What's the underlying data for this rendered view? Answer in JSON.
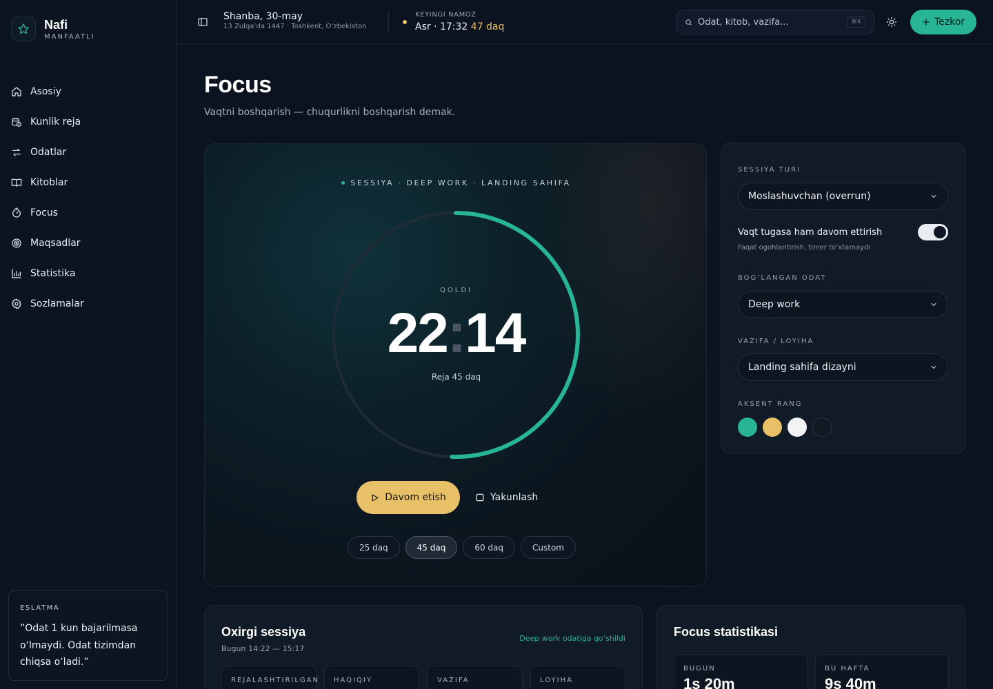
{
  "brand": {
    "name": "Nafi",
    "sub": "MANFAATLI"
  },
  "sidebar": {
    "items": [
      {
        "label": "Asosiy",
        "icon": "home-icon"
      },
      {
        "label": "Kunlik reja",
        "icon": "calendar-clock-icon"
      },
      {
        "label": "Odatlar",
        "icon": "repeat-icon"
      },
      {
        "label": "Kitoblar",
        "icon": "book-icon"
      },
      {
        "label": "Focus",
        "icon": "timer-icon"
      },
      {
        "label": "Maqsadlar",
        "icon": "target-icon"
      },
      {
        "label": "Statistika",
        "icon": "bar-chart-icon"
      },
      {
        "label": "Sozlamalar",
        "icon": "gear-icon"
      }
    ],
    "reminder": {
      "title": "ESLATMA",
      "text": "”Odat 1 kun bajarilmasa o‘lmaydi. Odat tizimdan chiqsa o‘ladi.”"
    }
  },
  "header": {
    "date_main": "Shanba, 30-may",
    "date_sub": "13 Zulqa’da 1447 · Toshkent, O‘zbekiston",
    "prayer_label": "KEYINGI NAMOZ",
    "prayer_value": "Asr · 17:32",
    "prayer_remaining": "47 daq",
    "search_placeholder": "Odat, kitob, vazifa...",
    "search_shortcut": "⌘K",
    "quick_label": "Tezkor"
  },
  "page": {
    "title": "Focus",
    "subtitle": "Vaqtni boshqarish — chuqurlikni boshqarish demak."
  },
  "timer": {
    "session_tag": "SESSIYA · DEEP WORK · LANDING SAHIFA",
    "remaining_label": "QOLDI",
    "minutes": "22",
    "seconds": "14",
    "plan": "Reja 45 daq",
    "progress_fraction": 0.505,
    "resume_label": "Davom etish",
    "finish_label": "Yakunlash",
    "presets": [
      "25 daq",
      "45 daq",
      "60 daq",
      "Custom"
    ],
    "active_preset": "45 daq"
  },
  "settings": {
    "session_type_label": "SESSIYA TURI",
    "session_type_value": "Moslashuvchan (overrun)",
    "toggle_title": "Vaqt tugasa ham davom ettirish",
    "toggle_sub": "Faqat ogohlantirish, timer to‘xtamaydi",
    "toggle_on": true,
    "habit_label": "BOG‘LANGAN ODAT",
    "habit_value": "Deep work",
    "task_label": "VAZIFA / LOYIHA",
    "task_value": "Landing sahifa dizayni",
    "accent_label": "AKSENT RANG",
    "accent_colors": [
      "#28b596",
      "#e7c068",
      "#f1f3f5",
      "#111821"
    ]
  },
  "last_session": {
    "title": "Oxirgi sessiya",
    "sub": "Bugun 14:22 — 15:17",
    "link": "Deep work odatiga qo‘shildi",
    "columns": [
      "REJALASHTIRILGAN",
      "HAQIQIY",
      "VAZIFA",
      "LOYIHA"
    ]
  },
  "stats": {
    "title": "Focus statistikasi",
    "today_label": "BUGUN",
    "today_value": "1s 20m",
    "week_label": "BU HAFTA",
    "week_value": "9s 40m"
  },
  "colors": {
    "accent_teal": "#28b596",
    "accent_gold": "#e7c068",
    "background": "#0b1220"
  }
}
